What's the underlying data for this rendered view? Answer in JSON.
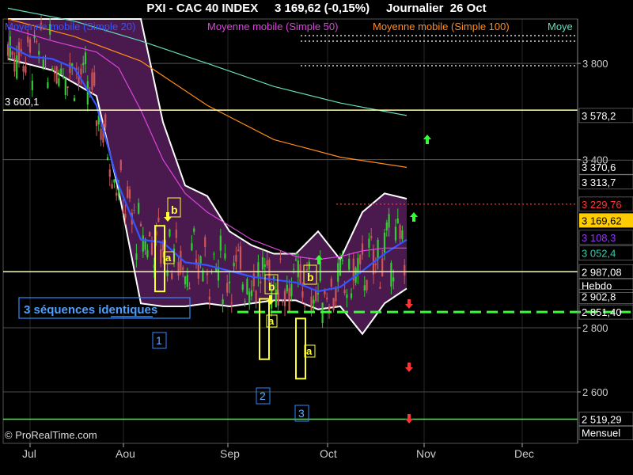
{
  "header": {
    "title": "PXI - CAC 40 INDEX     3 169,62 (-0,15%)     Journalier  26 Oct"
  },
  "legend": {
    "items": [
      {
        "text": "Moyenne mobile (Simple 20)",
        "color": "#3355ff"
      },
      {
        "text": "Moyenne mobile (Simple 50)",
        "color": "#dd44dd"
      },
      {
        "text": "Moyenne mobile (Simple 100)",
        "color": "#ff8c1a"
      },
      {
        "text": "Moye",
        "color": "#66ddbb"
      }
    ]
  },
  "watermark": "© ProRealTime.com",
  "annotations": {
    "sequence_label": "3 séquences identiques",
    "level_label_left": "3 600,1",
    "sequence_numbers": [
      "1",
      "2",
      "3"
    ],
    "letters_a": [
      "a",
      "a",
      "a"
    ],
    "letters_b": [
      "b",
      "b",
      "b"
    ]
  },
  "chart_data": {
    "type": "line",
    "title": "PXI - CAC 40 INDEX",
    "x_tick_labels": [
      "Jul",
      "Aou",
      "Sep",
      "Oct",
      "Nov",
      "Dec"
    ],
    "y_tick_labels": [
      "3 800",
      "3 400",
      "2 800",
      "2 600"
    ],
    "ylim": [
      2450,
      4000
    ],
    "scale": "log",
    "grid": true,
    "price_labels": [
      {
        "text": "3 578,2",
        "value": 3578.2,
        "color": "#ffffff",
        "bg": "#000000"
      },
      {
        "text": "3 370,6",
        "value": 3370.6,
        "color": "#ffffff",
        "bg": "#000000"
      },
      {
        "text": "3 313,7",
        "value": 3313.7,
        "color": "#ffffff",
        "bg": "#000000"
      },
      {
        "text": "3 229,76",
        "value": 3229.76,
        "color": "#ff3333",
        "bg": "#000000"
      },
      {
        "text": "3 169,62",
        "value": 3169.62,
        "color": "#000000",
        "bg": "#ffcc00"
      },
      {
        "text": "3 108,3",
        "value": 3108.3,
        "color": "#9933ff",
        "bg": "#000000"
      },
      {
        "text": "3 052,4",
        "value": 3052.4,
        "color": "#33ccaa",
        "bg": "#000000"
      },
      {
        "text": "2 987,08",
        "value": 2987.08,
        "color": "#ffffff",
        "bg": "#000000"
      },
      {
        "text": "Hebdo",
        "value": 2940,
        "color": "#ffffff",
        "bg": "#000000"
      },
      {
        "text": "2 902,8",
        "value": 2902.8,
        "color": "#ffffff",
        "bg": "#000000"
      },
      {
        "text": "2 851,40",
        "value": 2851.4,
        "color": "#ffffff",
        "bg": "#000000"
      },
      {
        "text": "2 519,29",
        "value": 2519.29,
        "color": "#ffffff",
        "bg": "#000000"
      },
      {
        "text": "Mensuel",
        "value": 2480,
        "color": "#ffffff",
        "bg": "#000000"
      }
    ],
    "horizontal_levels": [
      {
        "value": 3600.1,
        "color": "#ffffaa",
        "style": "solid"
      },
      {
        "value": 2987.08,
        "color": "#ffffaa",
        "style": "solid"
      },
      {
        "value": 2851.4,
        "color": "#33ff33",
        "style": "dashed"
      },
      {
        "value": 2519.29,
        "color": "#33ff33",
        "style": "solid"
      },
      {
        "value": 3229.76,
        "color": "#ff3333",
        "style": "dotted"
      }
    ],
    "series": [
      {
        "name": "Moyenne mobile (Simple 20)",
        "color": "#3355ff",
        "x": [
          0,
          10,
          20,
          30,
          40,
          50,
          60,
          70,
          80,
          90,
          100,
          110,
          120,
          130,
          140,
          150,
          160,
          170,
          180
        ],
        "values": [
          3880,
          3830,
          3820,
          3780,
          3620,
          3300,
          3100,
          3090,
          3020,
          3010,
          2990,
          2970,
          2960,
          2950,
          2920,
          2935,
          2990,
          3050,
          3100
        ]
      },
      {
        "name": "Moyenne mobile (Simple 50)",
        "color": "#dd44dd",
        "x": [
          0,
          20,
          40,
          50,
          60,
          70,
          80,
          90,
          100,
          110,
          120,
          130,
          140,
          150,
          160,
          170,
          180
        ],
        "values": [
          3960,
          3900,
          3850,
          3780,
          3600,
          3400,
          3270,
          3200,
          3150,
          3100,
          3070,
          3040,
          3030,
          3040,
          3060,
          3070,
          3070
        ]
      },
      {
        "name": "Moyenne mobile (Simple 100)",
        "color": "#ff8c1a",
        "x": [
          0,
          30,
          60,
          90,
          120,
          150,
          180
        ],
        "values": [
          4000,
          3920,
          3810,
          3620,
          3480,
          3410,
          3370
        ]
      },
      {
        "name": "Moye",
        "color": "#66ddbb",
        "x": [
          0,
          30,
          60,
          90,
          120,
          150,
          180
        ],
        "values": [
          4050,
          3990,
          3900,
          3800,
          3700,
          3630,
          3578
        ]
      }
    ],
    "bollinger": {
      "x": [
        0,
        20,
        40,
        50,
        60,
        70,
        80,
        90,
        100,
        110,
        120,
        130,
        140,
        150,
        160,
        170,
        180
      ],
      "upper": [
        4000,
        4000,
        4000,
        4000,
        4000,
        3550,
        3300,
        3260,
        3130,
        3080,
        3050,
        3050,
        3130,
        3030,
        3200,
        3270,
        3250
      ],
      "lower": [
        3820,
        3770,
        3660,
        3280,
        2880,
        2870,
        2870,
        2880,
        2870,
        2880,
        2890,
        2890,
        2860,
        2870,
        2780,
        2880,
        2930
      ]
    }
  }
}
